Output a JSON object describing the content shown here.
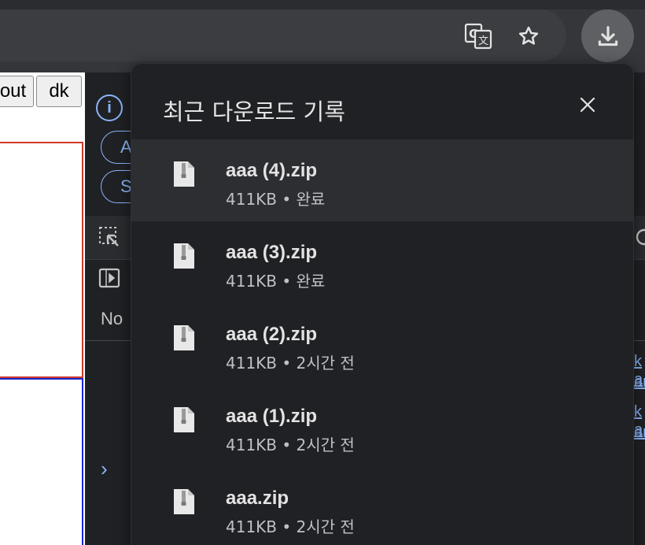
{
  "browser": {
    "translate_icon": "translate-icon",
    "bookmark_icon": "star-icon",
    "downloads_icon": "download-icon"
  },
  "page": {
    "buttons": [
      {
        "label": "out"
      },
      {
        "label": "dk"
      }
    ]
  },
  "devtools": {
    "pills": [
      "A",
      "S"
    ],
    "no_label": "No",
    "side_links": [
      "k a",
      "am",
      "k a",
      "am"
    ]
  },
  "downloads_popup": {
    "title": "최근 다운로드 기록",
    "close_icon": "close-icon",
    "items": [
      {
        "filename": "aaa (4).zip",
        "size": "411KB",
        "status": "완료",
        "meta": "411KB • 완료"
      },
      {
        "filename": "aaa (3).zip",
        "size": "411KB",
        "status": "완료",
        "meta": "411KB • 완료"
      },
      {
        "filename": "aaa (2).zip",
        "size": "411KB",
        "status": "2시간 전",
        "meta": "411KB • 2시간 전"
      },
      {
        "filename": "aaa (1).zip",
        "size": "411KB",
        "status": "2시간 전",
        "meta": "411KB • 2시간 전"
      },
      {
        "filename": "aaa.zip",
        "size": "411KB",
        "status": "2시간 전",
        "meta": "411KB • 2시간 전"
      }
    ]
  },
  "colors": {
    "accent": "#8ab4f8",
    "popup_bg": "#202124",
    "item_hover": "#2d2e31",
    "text_primary": "#e3e3e3",
    "text_secondary": "#bdc1c6"
  }
}
